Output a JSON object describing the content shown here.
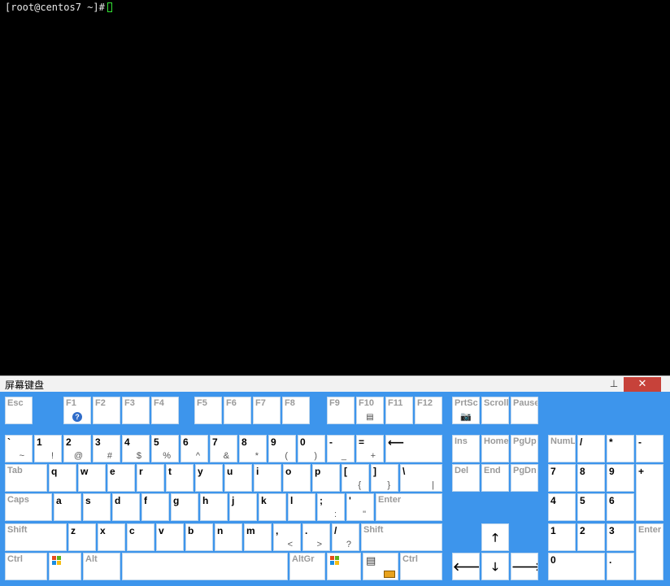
{
  "terminal": {
    "prompt": "[root@centos7 ~]#"
  },
  "osk": {
    "title": "屏幕键盘",
    "close_label": "✕",
    "pin_label": "📌"
  },
  "keys": {
    "esc": "Esc",
    "f1": "F1",
    "f2": "F2",
    "f3": "F3",
    "f4": "F4",
    "f5": "F5",
    "f6": "F6",
    "f7": "F7",
    "f8": "F8",
    "f9": "F9",
    "f10": "F10",
    "f11": "F11",
    "f12": "F12",
    "prtsc": "PrtSc",
    "scroll": "Scroll",
    "pause": "Pause",
    "backtick": "`",
    "tilde": "~",
    "n1": "1",
    "s1": "!",
    "n2": "2",
    "s2": "@",
    "n3": "3",
    "s3": "#",
    "n4": "4",
    "s4": "$",
    "n5": "5",
    "s5": "%",
    "n6": "6",
    "s6": "^",
    "n7": "7",
    "s7": "&",
    "n8": "8",
    "s8": "*",
    "n9": "9",
    "s9": "(",
    "n0": "0",
    "s0": ")",
    "minus": "-",
    "underscore": "_",
    "equal": "=",
    "plus": "+",
    "backspace": "⟵",
    "ins": "Ins",
    "home": "Home",
    "pgup": "PgUp",
    "numl": "NumL",
    "np_slash": "/",
    "np_star": "*",
    "np_minus": "-",
    "tab": "Tab",
    "q": "q",
    "w": "w",
    "e": "e",
    "r": "r",
    "t": "t",
    "y": "y",
    "u": "u",
    "i": "i",
    "o": "o",
    "p": "p",
    "lbracket": "[",
    "lbrace": "{",
    "rbracket": "]",
    "rbrace": "}",
    "backslash": "\\",
    "pipe": "|",
    "del": "Del",
    "end": "End",
    "pgdn": "PgDn",
    "np7": "7",
    "np8": "8",
    "np9": "9",
    "np_plus": "+",
    "caps": "Caps",
    "a": "a",
    "s": "s",
    "d": "d",
    "f": "f",
    "g": "g",
    "h": "h",
    "j": "j",
    "k": "k",
    "l": "l",
    "semicolon": ";",
    "colon": ":",
    "quote": "'",
    "dquote": "\"",
    "enter": "Enter",
    "np4": "4",
    "np5": "5",
    "np6": "6",
    "shift_l": "Shift",
    "z": "z",
    "x": "x",
    "c": "c",
    "v": "v",
    "b": "b",
    "n": "n",
    "m": "m",
    "comma": ",",
    "lt": "<",
    "period": ".",
    "gt": ">",
    "slash": "/",
    "question": "?",
    "shift_r": "Shift",
    "up": "🡑",
    "np1": "1",
    "np2": "2",
    "np3": "3",
    "np_enter": "Enter",
    "ctrl_l": "Ctrl",
    "alt": "Alt",
    "altgr": "AltGr",
    "ctrl_r": "Ctrl",
    "left": "🡐",
    "down": "🡓",
    "right": "🡒",
    "np0": "0",
    "np_dot": "."
  },
  "colors": {
    "osk_background": "#3d95ec",
    "key_background": "#ffffff",
    "close_button": "#c7423a",
    "cursor": "#34e234"
  }
}
